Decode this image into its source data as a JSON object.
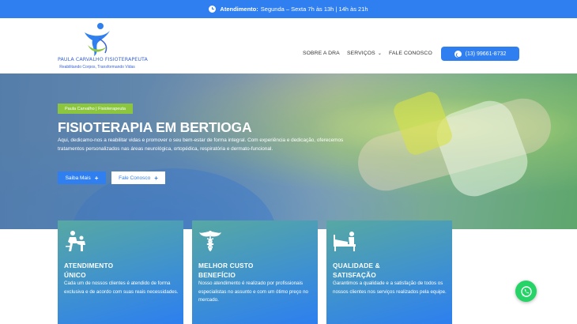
{
  "topbar": {
    "label": "Atendimento:",
    "hours": "Segunda – Sexta 7h às 13h | 14h às 21h",
    "icon": "clock-icon"
  },
  "logo": {
    "name": "PAULA CARVALHO FISIOTERAPEUTA",
    "tagline": "Reabilitando Corpos, Transformando Vidas"
  },
  "nav": {
    "items": [
      {
        "label": "SOBRE A DRA"
      },
      {
        "label": "SERVIÇOS"
      },
      {
        "label": "FALE CONOSCO"
      }
    ],
    "phone": "(13) 99661-8732"
  },
  "hero": {
    "badge": "Paula Carvalho | Fisioterapeuta",
    "title": "FISIOTERAPIA EM BERTIOGA",
    "text": "Aqui, dedicamo-nos a reabilitar vidas e promover o seu bem-estar de forma integral. Com experiência e dedicação, oferecemos tratamentos personalizados nas áreas neurológica, ortopédica, respiratória e dermato-funcional.",
    "btn_primary": "Saiba Mais",
    "btn_secondary": "Fale Conosco"
  },
  "cards": [
    {
      "title_1": "ATENDIMENTO",
      "title_2": "ÚNICO",
      "text": "Cada um de nossos clientes é atendido de forma exclusiva e de acordo com suas reais necessidades.",
      "icon": "physiotherapy-icon"
    },
    {
      "title_1": "MELHOR CUSTO",
      "title_2": "BENEFÍCIO",
      "text": "Nosso atendimento é realizado por profissionais especialistas no assunto e com um ótimo preço no mercado.",
      "icon": "caduceus-icon"
    },
    {
      "title_1": "QUALIDADE &",
      "title_2": "SATISFAÇÃO",
      "text": "Garantimos a qualidade e a satisfação de todos os nossos clientes nos serviços realizados pela equipe.",
      "icon": "patient-bed-icon"
    }
  ],
  "colors": {
    "primary": "#2f7ff0",
    "accent_green": "#8cc63f",
    "whatsapp": "#25d366"
  }
}
